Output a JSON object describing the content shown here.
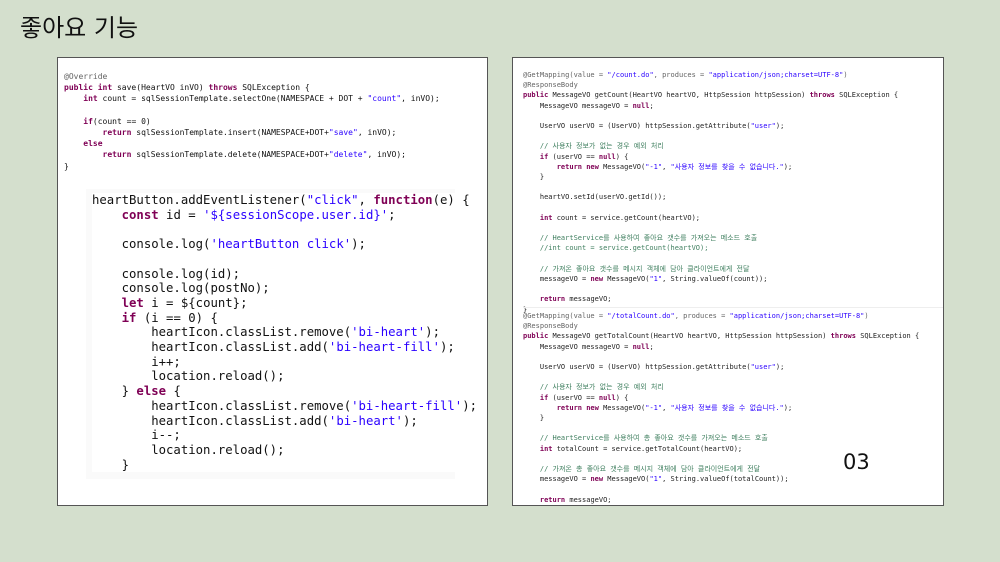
{
  "title": "좋아요 기능",
  "page_number": "03",
  "left_java": [
    [
      [
        "an",
        "@Override"
      ]
    ],
    [
      [
        "kw",
        "public int "
      ],
      [
        "t",
        "save(HeartVO inVO) "
      ],
      [
        "kw",
        "throws "
      ],
      [
        "t",
        "SQLException {"
      ]
    ],
    [
      [
        "t",
        "    "
      ],
      [
        "kw",
        "int "
      ],
      [
        "t",
        "count = sqlSessionTemplate.selectOne(NAMESPACE + DOT + "
      ],
      [
        "str",
        "\"count\""
      ],
      [
        "t",
        ", inVO);"
      ]
    ],
    [
      [
        "t",
        ""
      ]
    ],
    [
      [
        "t",
        "    "
      ],
      [
        "kw",
        "if"
      ],
      [
        "t",
        "(count == 0)"
      ]
    ],
    [
      [
        "t",
        "        "
      ],
      [
        "kw",
        "return "
      ],
      [
        "t",
        "sqlSessionTemplate.insert(NAMESPACE+DOT+"
      ],
      [
        "str",
        "\"save\""
      ],
      [
        "t",
        ", inVO);"
      ]
    ],
    [
      [
        "t",
        "    "
      ],
      [
        "kw",
        "else"
      ]
    ],
    [
      [
        "t",
        "        "
      ],
      [
        "kw",
        "return "
      ],
      [
        "t",
        "sqlSessionTemplate.delete(NAMESPACE+DOT+"
      ],
      [
        "str",
        "\"delete\""
      ],
      [
        "t",
        ", inVO);"
      ]
    ],
    [
      [
        "t",
        "}"
      ]
    ]
  ],
  "left_js": [
    [
      [
        "t",
        "heartButton.addEventListener("
      ],
      [
        "str",
        "\"click\""
      ],
      [
        "t",
        ", "
      ],
      [
        "kw",
        "function"
      ],
      [
        "t",
        "(e) {"
      ]
    ],
    [
      [
        "t",
        "    "
      ],
      [
        "kw",
        "const "
      ],
      [
        "t",
        "id = "
      ],
      [
        "str",
        "'${sessionScope.user.id}'"
      ],
      [
        "t",
        ";"
      ]
    ],
    [
      [
        "t",
        ""
      ]
    ],
    [
      [
        "t",
        "    console.log("
      ],
      [
        "str",
        "'heartButton click'"
      ],
      [
        "t",
        ");"
      ]
    ],
    [
      [
        "t",
        ""
      ]
    ],
    [
      [
        "t",
        "    console.log(id);"
      ]
    ],
    [
      [
        "t",
        "    console.log(postNo);"
      ]
    ],
    [
      [
        "t",
        "    "
      ],
      [
        "kw",
        "let "
      ],
      [
        "t",
        "i = ${count};"
      ]
    ],
    [
      [
        "t",
        "    "
      ],
      [
        "kw",
        "if "
      ],
      [
        "t",
        "(i == 0) {"
      ]
    ],
    [
      [
        "t",
        "        heartIcon.classList.remove("
      ],
      [
        "str",
        "'bi-heart'"
      ],
      [
        "t",
        ");"
      ]
    ],
    [
      [
        "t",
        "        heartIcon.classList.add("
      ],
      [
        "str",
        "'bi-heart-fill'"
      ],
      [
        "t",
        ");"
      ]
    ],
    [
      [
        "t",
        "        i++;"
      ]
    ],
    [
      [
        "t",
        "        location.reload();"
      ]
    ],
    [
      [
        "t",
        "    } "
      ],
      [
        "kw",
        "else "
      ],
      [
        "t",
        "{"
      ]
    ],
    [
      [
        "t",
        "        heartIcon.classList.remove("
      ],
      [
        "str",
        "'bi-heart-fill'"
      ],
      [
        "t",
        ");"
      ]
    ],
    [
      [
        "t",
        "        heartIcon.classList.add("
      ],
      [
        "str",
        "'bi-heart'"
      ],
      [
        "t",
        ");"
      ]
    ],
    [
      [
        "t",
        "        i--;"
      ]
    ],
    [
      [
        "t",
        "        location.reload();"
      ]
    ],
    [
      [
        "t",
        "    }"
      ]
    ]
  ],
  "right_top": [
    [
      [
        "an",
        "@GetMapping(value = "
      ],
      [
        "str",
        "\"/count.do\""
      ],
      [
        "an",
        ", produces = "
      ],
      [
        "str",
        "\"application/json;charset=UTF-8\""
      ],
      [
        "an",
        ")"
      ]
    ],
    [
      [
        "an",
        "@ResponseBody"
      ]
    ],
    [
      [
        "kw",
        "public "
      ],
      [
        "t",
        "MessageVO getCount(HeartVO heartVO, HttpSession httpSession) "
      ],
      [
        "kw",
        "throws "
      ],
      [
        "t",
        "SQLException {"
      ]
    ],
    [
      [
        "t",
        "    MessageVO messageVO = "
      ],
      [
        "kw",
        "null"
      ],
      [
        "t",
        ";"
      ]
    ],
    [
      [
        "t",
        ""
      ]
    ],
    [
      [
        "t",
        "    UserVO userVO = (UserVO) httpSession.getAttribute("
      ],
      [
        "str",
        "\"user\""
      ],
      [
        "t",
        ");"
      ]
    ],
    [
      [
        "t",
        ""
      ]
    ],
    [
      [
        "cm",
        "    // 사용자 정보가 없는 경우 예외 처리"
      ]
    ],
    [
      [
        "t",
        "    "
      ],
      [
        "kw",
        "if "
      ],
      [
        "t",
        "(userVO == "
      ],
      [
        "kw",
        "null"
      ],
      [
        "t",
        ") {"
      ]
    ],
    [
      [
        "t",
        "        "
      ],
      [
        "kw",
        "return new "
      ],
      [
        "t",
        "MessageVO("
      ],
      [
        "str",
        "\"-1\""
      ],
      [
        "t",
        ", "
      ],
      [
        "str",
        "\"사용자 정보를 찾을 수 없습니다.\""
      ],
      [
        "t",
        ");"
      ]
    ],
    [
      [
        "t",
        "    }"
      ]
    ],
    [
      [
        "t",
        ""
      ]
    ],
    [
      [
        "t",
        "    heartVO.setId(userVO.getId());"
      ]
    ],
    [
      [
        "t",
        ""
      ]
    ],
    [
      [
        "t",
        "    "
      ],
      [
        "kw",
        "int "
      ],
      [
        "t",
        "count = service.getCount(heartVO);"
      ]
    ],
    [
      [
        "t",
        ""
      ]
    ],
    [
      [
        "cm",
        "    // HeartService를 사용하여 좋아요 갯수를 가져오는 메소드 호출"
      ]
    ],
    [
      [
        "cm",
        "    //int count = service.getCount(heartVO);"
      ]
    ],
    [
      [
        "t",
        ""
      ]
    ],
    [
      [
        "cm",
        "    // 가져온 좋아요 갯수를 메시지 객체에 담아 클라이언트에게 전달"
      ]
    ],
    [
      [
        "t",
        "    messageVO = "
      ],
      [
        "kw",
        "new "
      ],
      [
        "t",
        "MessageVO("
      ],
      [
        "str",
        "\"1\""
      ],
      [
        "t",
        ", String.valueOf(count));"
      ]
    ],
    [
      [
        "t",
        ""
      ]
    ],
    [
      [
        "t",
        "    "
      ],
      [
        "kw",
        "return "
      ],
      [
        "t",
        "messageVO;"
      ]
    ],
    [
      [
        "t",
        "}"
      ]
    ]
  ],
  "right_bottom": [
    [
      [
        "an",
        "@GetMapping(value = "
      ],
      [
        "str",
        "\"/totalCount.do\""
      ],
      [
        "an",
        ", produces = "
      ],
      [
        "str",
        "\"application/json;charset=UTF-8\""
      ],
      [
        "an",
        ")"
      ]
    ],
    [
      [
        "an",
        "@ResponseBody"
      ]
    ],
    [
      [
        "kw",
        "public "
      ],
      [
        "t",
        "MessageVO getTotalCount(HeartVO heartVO, HttpSession httpSession) "
      ],
      [
        "kw",
        "throws "
      ],
      [
        "t",
        "SQLException {"
      ]
    ],
    [
      [
        "t",
        "    MessageVO messageVO = "
      ],
      [
        "kw",
        "null"
      ],
      [
        "t",
        ";"
      ]
    ],
    [
      [
        "t",
        ""
      ]
    ],
    [
      [
        "t",
        "    UserVO userVO = (UserVO) httpSession.getAttribute("
      ],
      [
        "str",
        "\"user\""
      ],
      [
        "t",
        ");"
      ]
    ],
    [
      [
        "t",
        ""
      ]
    ],
    [
      [
        "cm",
        "    // 사용자 정보가 없는 경우 예외 처리"
      ]
    ],
    [
      [
        "t",
        "    "
      ],
      [
        "kw",
        "if "
      ],
      [
        "t",
        "(userVO == "
      ],
      [
        "kw",
        "null"
      ],
      [
        "t",
        ") {"
      ]
    ],
    [
      [
        "t",
        "        "
      ],
      [
        "kw",
        "return new "
      ],
      [
        "t",
        "MessageVO("
      ],
      [
        "str",
        "\"-1\""
      ],
      [
        "t",
        ", "
      ],
      [
        "str",
        "\"사용자 정보를 찾을 수 없습니다.\""
      ],
      [
        "t",
        ");"
      ]
    ],
    [
      [
        "t",
        "    }"
      ]
    ],
    [
      [
        "t",
        ""
      ]
    ],
    [
      [
        "cm",
        "    // HeartService를 사용하여 총 좋아요 갯수를 가져오는 메소드 호출"
      ]
    ],
    [
      [
        "t",
        "    "
      ],
      [
        "kw",
        "int "
      ],
      [
        "t",
        "totalCount = service.getTotalCount(heartVO);"
      ]
    ],
    [
      [
        "t",
        ""
      ]
    ],
    [
      [
        "cm",
        "    // 가져온 총 좋아요 갯수를 메시지 객체에 담아 클라이언트에게 전달"
      ]
    ],
    [
      [
        "t",
        "    messageVO = "
      ],
      [
        "kw",
        "new "
      ],
      [
        "t",
        "MessageVO("
      ],
      [
        "str",
        "\"1\""
      ],
      [
        "t",
        ", String.valueOf(totalCount));"
      ]
    ],
    [
      [
        "t",
        ""
      ]
    ],
    [
      [
        "t",
        "    "
      ],
      [
        "kw",
        "return "
      ],
      [
        "t",
        "messageVO;"
      ]
    ],
    [
      [
        "t",
        "}"
      ]
    ]
  ]
}
